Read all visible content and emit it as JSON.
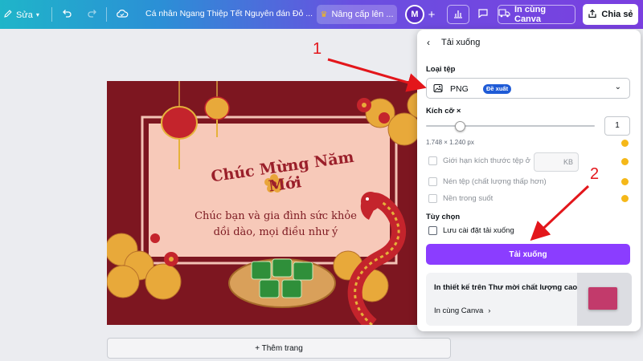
{
  "topbar": {
    "edit_label": "Sửa",
    "doc_title": "Cá nhân Ngang Thiệp Tết Nguyên đán Đỏ ...",
    "upgrade_label": "Nâng cấp lên ...",
    "avatar_letter": "M",
    "print_label": "In cùng Canva",
    "share_label": "Chia sẻ"
  },
  "card": {
    "title": "Chúc Mừng Năm Mới",
    "message_line1": "Chúc bạn và gia đình sức khỏe",
    "message_line2": "dồi dào, mọi điều như ý"
  },
  "annotations": {
    "arrow1_label": "1",
    "arrow2_label": "2"
  },
  "add_page_label": "+ Thêm trang",
  "panel": {
    "header": "Tải xuống",
    "file_type_label": "Loại tệp",
    "file_type_value": "PNG",
    "recommended_badge": "Đề xuất",
    "size_label": "Kích cỡ ×",
    "size_value": "1",
    "size_dims": "1.748 × 1.240 px",
    "option_limit_size": "Giới hạn kích thước tệp ở",
    "kb_unit": "KB",
    "option_compress": "Nén tệp (chất lượng thấp hơn)",
    "option_transparent": "Nền trong suốt",
    "options_label": "Tùy chọn",
    "save_settings": "Lưu cài đặt tải xuống",
    "download_button": "Tải xuống",
    "promo_title": "In thiết kế trên Thư mời chất lượng cao",
    "promo_link": "In cùng Canva"
  },
  "colors": {
    "accent_purple": "#8b3dff",
    "card_red": "#7d1620",
    "badge_blue": "#1f5bd6",
    "annotation_red": "#e3161b"
  }
}
